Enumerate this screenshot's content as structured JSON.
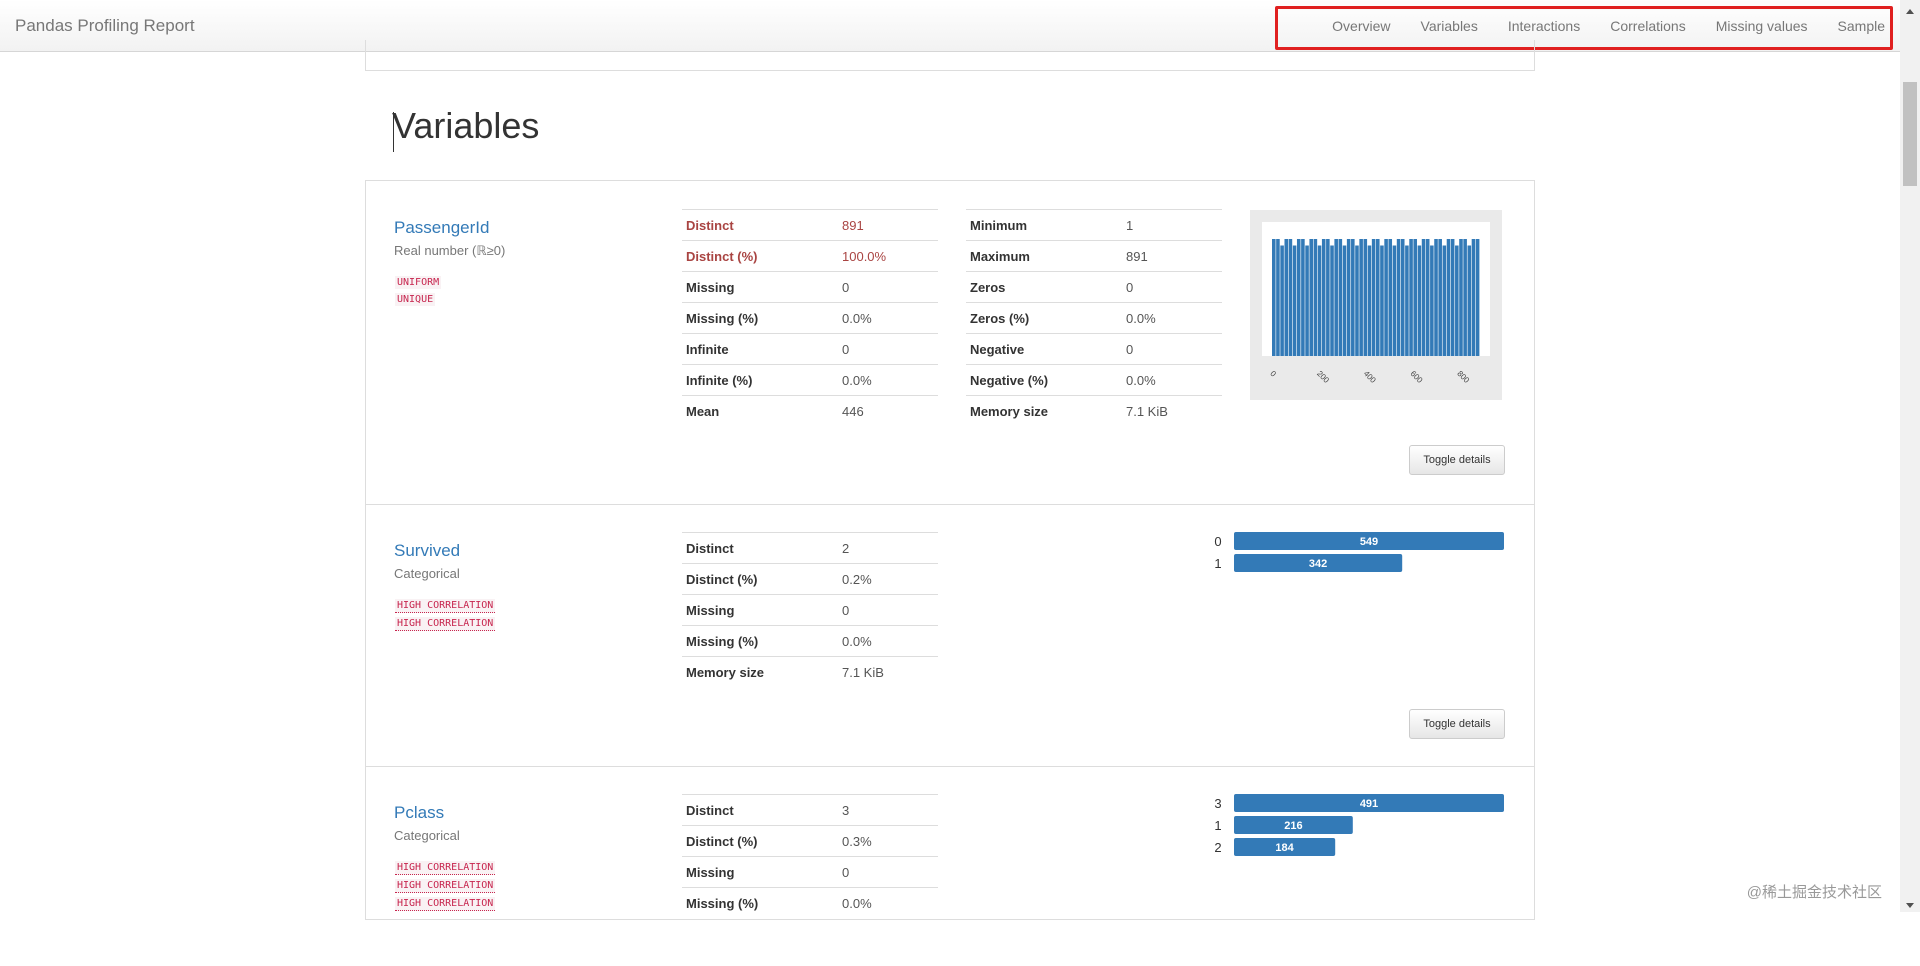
{
  "navbar": {
    "brand": "Pandas Profiling Report",
    "links": [
      "Overview",
      "Variables",
      "Interactions",
      "Correlations",
      "Missing values",
      "Sample"
    ]
  },
  "section": {
    "title": "Variables"
  },
  "variables": [
    {
      "name": "PassengerId",
      "type": "Real number (ℝ≥0)",
      "badges": [
        "UNIFORM",
        "UNIQUE"
      ],
      "stats_left": [
        {
          "label": "Distinct",
          "value": "891",
          "alert": true
        },
        {
          "label": "Distinct (%)",
          "value": "100.0%",
          "alert": true
        },
        {
          "label": "Missing",
          "value": "0"
        },
        {
          "label": "Missing (%)",
          "value": "0.0%"
        },
        {
          "label": "Infinite",
          "value": "0"
        },
        {
          "label": "Infinite (%)",
          "value": "0.0%"
        },
        {
          "label": "Mean",
          "value": "446"
        }
      ],
      "stats_right": [
        {
          "label": "Minimum",
          "value": "1"
        },
        {
          "label": "Maximum",
          "value": "891"
        },
        {
          "label": "Zeros",
          "value": "0"
        },
        {
          "label": "Zeros (%)",
          "value": "0.0%"
        },
        {
          "label": "Negative",
          "value": "0"
        },
        {
          "label": "Negative (%)",
          "value": "0.0%"
        },
        {
          "label": "Memory size",
          "value": "7.1 KiB"
        }
      ],
      "toggle_label": "Toggle details"
    },
    {
      "name": "Survived",
      "type": "Categorical",
      "badges": [
        "HIGH CORRELATION",
        "HIGH CORRELATION"
      ],
      "stats_left": [
        {
          "label": "Distinct",
          "value": "2"
        },
        {
          "label": "Distinct (%)",
          "value": "0.2%"
        },
        {
          "label": "Missing",
          "value": "0"
        },
        {
          "label": "Missing (%)",
          "value": "0.0%"
        },
        {
          "label": "Memory size",
          "value": "7.1 KiB"
        }
      ],
      "toggle_label": "Toggle details"
    },
    {
      "name": "Pclass",
      "type": "Categorical",
      "badges": [
        "HIGH CORRELATION",
        "HIGH CORRELATION",
        "HIGH CORRELATION"
      ],
      "stats_left": [
        {
          "label": "Distinct",
          "value": "3"
        },
        {
          "label": "Distinct (%)",
          "value": "0.3%"
        },
        {
          "label": "Missing",
          "value": "0"
        },
        {
          "label": "Missing (%)",
          "value": "0.0%"
        }
      ]
    }
  ],
  "chart_data": [
    {
      "type": "bar",
      "title": "",
      "xlabel": "",
      "ylabel": "",
      "x_ticks": [
        "0",
        "200",
        "400",
        "600",
        "800"
      ],
      "bin_count": 50,
      "values": [
        18,
        18,
        17,
        18,
        18,
        17,
        18,
        18,
        17,
        18,
        18,
        17,
        18,
        18,
        17,
        18,
        18,
        17,
        18,
        18,
        17,
        18,
        18,
        17,
        18,
        18,
        17,
        18,
        18,
        17,
        18,
        18,
        17,
        18,
        18,
        17,
        18,
        18,
        17,
        18,
        18,
        17,
        18,
        18,
        17,
        18,
        18,
        17,
        18,
        18
      ],
      "xlim": [
        1,
        891
      ],
      "color": "#337ab7"
    },
    {
      "type": "bar",
      "orientation": "horizontal",
      "categories": [
        "0",
        "1"
      ],
      "values": [
        549,
        342
      ],
      "color": "#337ab7"
    },
    {
      "type": "bar",
      "orientation": "horizontal",
      "categories": [
        "3",
        "1",
        "2"
      ],
      "values": [
        491,
        216,
        184
      ],
      "color": "#337ab7"
    }
  ],
  "watermark": "@稀土掘金技术社区",
  "colors": {
    "link": "#337ab7",
    "bar": "#337ab7",
    "alert": "#a94442",
    "highlight": "#e02020"
  }
}
